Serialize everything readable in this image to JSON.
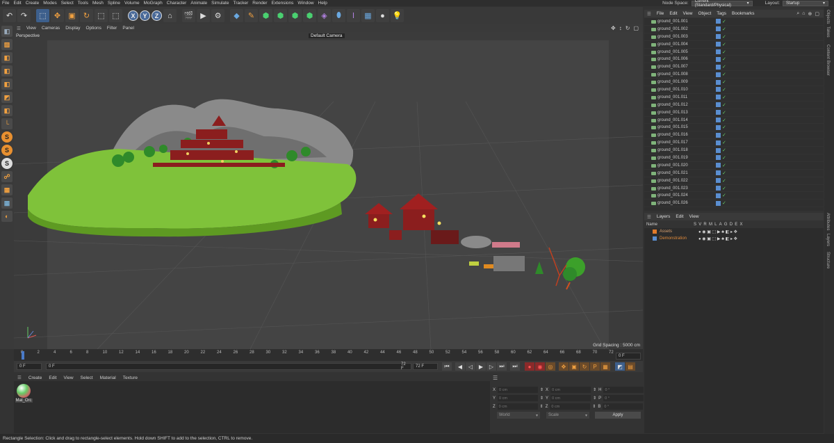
{
  "menubar": {
    "items": [
      "File",
      "Edit",
      "Create",
      "Modes",
      "Select",
      "Tools",
      "Mesh",
      "Spline",
      "Volume",
      "MoGraph",
      "Character",
      "Animate",
      "Simulate",
      "Tracker",
      "Render",
      "Extensions",
      "Window",
      "Help"
    ],
    "node_space_label": "Node Space:",
    "node_space_value": "Current (Standard/Physical)",
    "layout_label": "Layout:",
    "layout_value": "Startup"
  },
  "toolbar": {
    "xyz": [
      "X",
      "Y",
      "Z"
    ]
  },
  "viewport": {
    "menu": [
      "View",
      "Cameras",
      "Display",
      "Options",
      "Filter",
      "Panel"
    ],
    "label": "Perspective",
    "camera": "Default Camera",
    "grid_spacing": "Grid Spacing : 5000 cm"
  },
  "timeline": {
    "ticks": [
      "0",
      "2",
      "4",
      "6",
      "8",
      "10",
      "12",
      "14",
      "16",
      "18",
      "20",
      "22",
      "24",
      "26",
      "28",
      "30",
      "32",
      "34",
      "36",
      "38",
      "40",
      "42",
      "44",
      "46",
      "48",
      "50",
      "52",
      "54",
      "56",
      "58",
      "60",
      "62",
      "64",
      "66",
      "68",
      "70",
      "72"
    ],
    "end_marker": "0 F",
    "start_field": "0 F",
    "current_field": "0 F",
    "end_field": "72 F",
    "end_field2": "72 F"
  },
  "material_manager": {
    "menu": [
      "Create",
      "Edit",
      "View",
      "Select",
      "Material",
      "Texture"
    ],
    "material_name": "Mat_Orc"
  },
  "coordinates": {
    "rows": [
      {
        "a": "X",
        "av": "0 cm",
        "b": "X",
        "bv": "0 cm",
        "c": "H",
        "cv": "0 °"
      },
      {
        "a": "Y",
        "av": "0 cm",
        "b": "Y",
        "bv": "0 cm",
        "c": "P",
        "cv": "0 °"
      },
      {
        "a": "Z",
        "av": "0 cm",
        "b": "Z",
        "bv": "0 cm",
        "c": "B",
        "cv": "0 °"
      }
    ],
    "mode": "World",
    "scale": "Scale",
    "apply": "Apply"
  },
  "status": "Rectangle Selection: Click and drag to rectangle-select elements. Hold down SHIFT to add to the selection, CTRL to remove.",
  "object_manager": {
    "menu": [
      "File",
      "Edit",
      "View",
      "Object",
      "Tags",
      "Bookmarks"
    ],
    "objects": [
      "ground_001.001",
      "ground_001.002",
      "ground_001.003",
      "ground_001.004",
      "ground_001.005",
      "ground_001.006",
      "ground_001.007",
      "ground_001.008",
      "ground_001.009",
      "ground_001.010",
      "ground_001.011",
      "ground_001.012",
      "ground_001.013",
      "ground_001.014",
      "ground_001.015",
      "ground_001.016",
      "ground_001.017",
      "ground_001.018",
      "ground_001.019",
      "ground_001.020",
      "ground_001.021",
      "ground_001.022",
      "ground_001.023",
      "ground_001.024",
      "ground_001.026"
    ]
  },
  "layers": {
    "menu": [
      "Layers",
      "Edit",
      "View"
    ],
    "header": {
      "name": "Name",
      "cols": [
        "S",
        "V",
        "R",
        "M",
        "L",
        "A",
        "G",
        "D",
        "E",
        "X"
      ]
    },
    "items": [
      {
        "name": "Assets",
        "color": "#e07a2a",
        "text_color": "#d8a070"
      },
      {
        "name": "Demonstration",
        "color": "#5a8ed0",
        "text_color": "#e08a3a"
      }
    ]
  },
  "side_tabs": [
    "Objects",
    "Takes",
    "Content Browser",
    "Attributes",
    "Layers",
    "Structure"
  ]
}
